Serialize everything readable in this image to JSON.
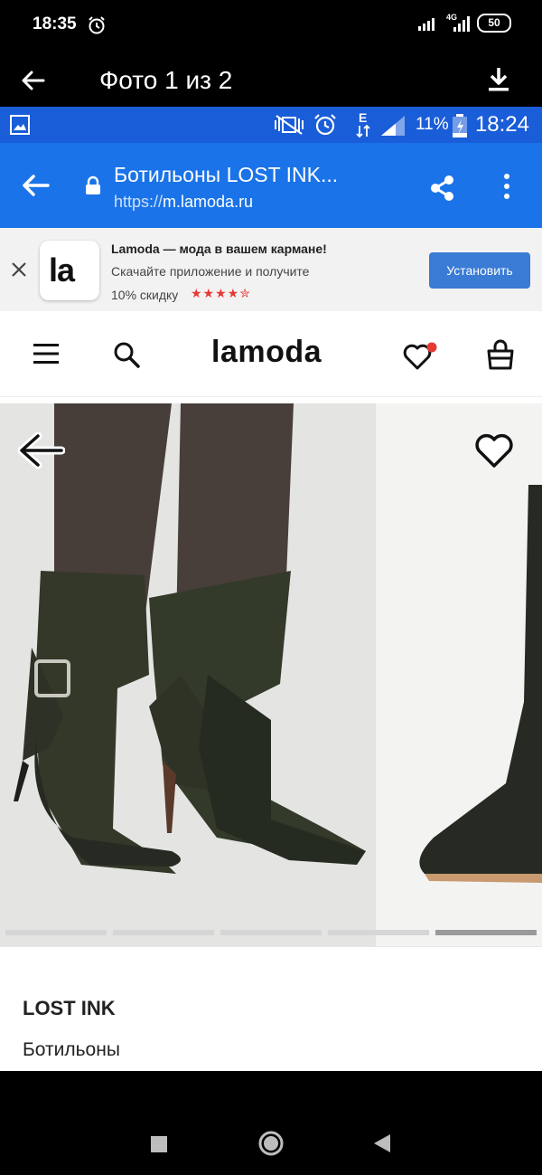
{
  "outer_status": {
    "time": "18:35",
    "network": "4G",
    "battery": "50"
  },
  "viewer": {
    "title": "Фото 1 из 2"
  },
  "inner_status": {
    "battery_pct": "11%",
    "time": "18:24",
    "data": "E"
  },
  "browser": {
    "page_title": "Ботильоны LOST INK...",
    "url_scheme": "https://",
    "url_host": "m.lamoda.ru"
  },
  "banner": {
    "logo_text": "la",
    "title": "Lamoda — мода в вашем кармане!",
    "subtitle": "Скачайте приложение и получите",
    "discount": "10% скидку",
    "stars": "★★★★✮",
    "install_label": "Установить"
  },
  "site": {
    "logo": "lamoda"
  },
  "gallery": {
    "dots": 5,
    "active_dot": 4
  },
  "product": {
    "brand": "LOST INK",
    "name": "Ботильоны"
  },
  "colors": {
    "browser_blue": "#1a73e8",
    "status_blue": "#1a5dd8",
    "install_blue": "#3a7bd5",
    "star_red": "#e53935",
    "notify_red": "#e53935"
  }
}
